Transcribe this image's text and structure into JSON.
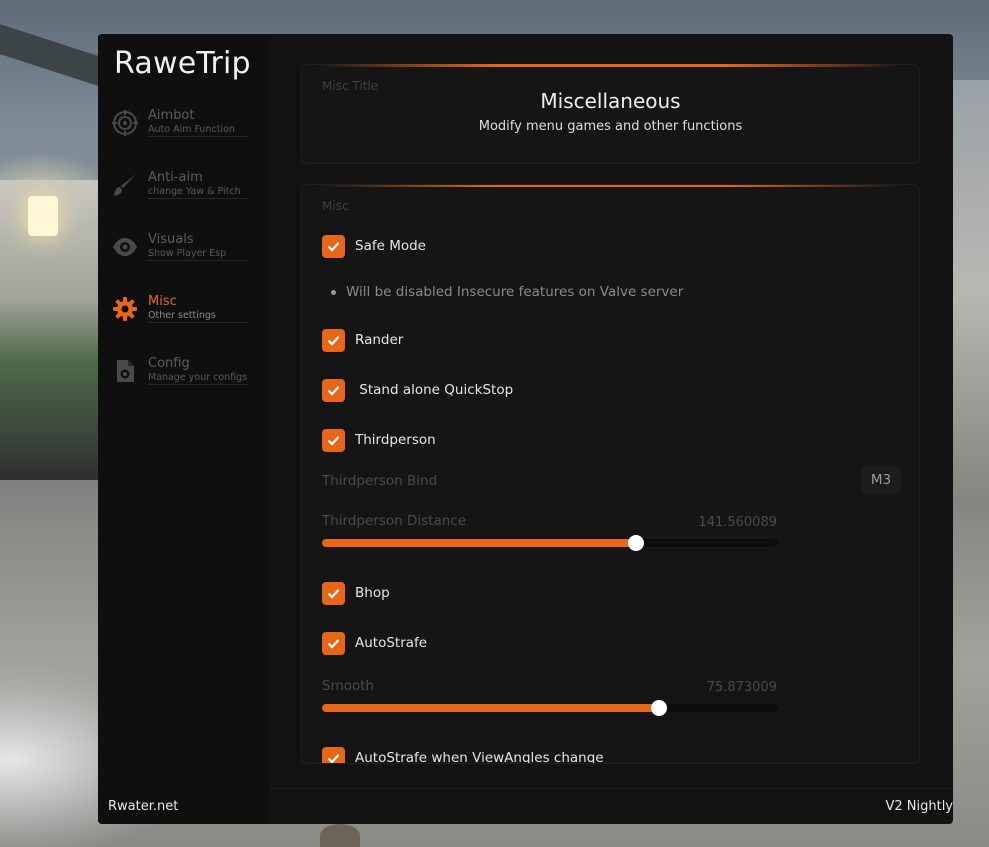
{
  "app": {
    "brand": "RaweTrip",
    "footer_left": "Rwater.net",
    "footer_right": "V2 Nightly",
    "accent": "#e8661a"
  },
  "sidebar": {
    "items": [
      {
        "icon": "crosshair-icon",
        "label": "Aimbot",
        "sub": "Auto Aim Function",
        "active": false
      },
      {
        "icon": "brush-icon",
        "label": "Anti-aim",
        "sub": "change Yaw & Pitch",
        "active": false
      },
      {
        "icon": "eye-icon",
        "label": "Visuals",
        "sub": "Show Player Esp",
        "active": false
      },
      {
        "icon": "gear-icon",
        "label": "Misc",
        "sub": "Other settings",
        "active": true
      },
      {
        "icon": "config-file-icon",
        "label": "Config",
        "sub": "Manage your configs",
        "active": false
      }
    ]
  },
  "title_card": {
    "label": "Misc Title",
    "title": "Miscellaneous",
    "subtitle": "Modify menu games and other functions"
  },
  "misc_card": {
    "label": "Misc",
    "safe_mode": {
      "label": "Safe Mode",
      "checked": true
    },
    "info": "Will be disabled Insecure features on Valve server",
    "rander": {
      "label": "Rander",
      "checked": true
    },
    "quickstop": {
      "label": " Stand alone QuickStop",
      "checked": true
    },
    "thirdperson": {
      "label": "Thirdperson",
      "checked": true
    },
    "thirdperson_bind": {
      "label": "Thirdperson Bind",
      "key": "M3"
    },
    "thirdperson_distance": {
      "label": "Thirdperson Distance",
      "value": "141.560089",
      "fraction": 0.689
    },
    "bhop": {
      "label": "Bhop",
      "checked": true
    },
    "autostrafe": {
      "label": "AutoStrafe",
      "checked": true
    },
    "smooth": {
      "label": "Smooth",
      "value": "75.873009",
      "fraction": 0.74
    },
    "autostrafe_viewangles": {
      "label": "AutoStrafe when ViewAngles change",
      "checked": true
    }
  }
}
